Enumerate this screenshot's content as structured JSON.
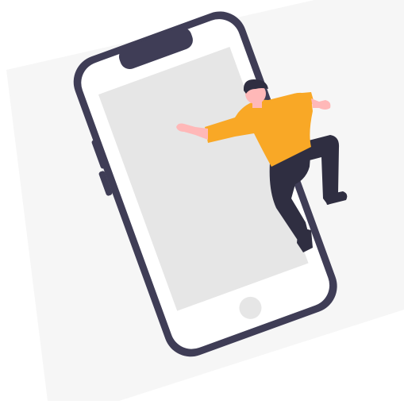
{
  "illustration": {
    "subject": "person-climbing-out-of-smartphone",
    "icons": [
      "smartphone-icon",
      "person-figure-icon",
      "home-button-icon"
    ],
    "colors": {
      "background_tint": "#f6f6f6",
      "phone_frame": "#3f3d56",
      "phone_body": "#ffffff",
      "phone_screen": "#e6e6e6",
      "home_button": "#e6e6e6",
      "shirt": "#f9a826",
      "pants": "#2f2e41",
      "skin": "#ffb8b8",
      "hair": "#2f2e41"
    }
  }
}
